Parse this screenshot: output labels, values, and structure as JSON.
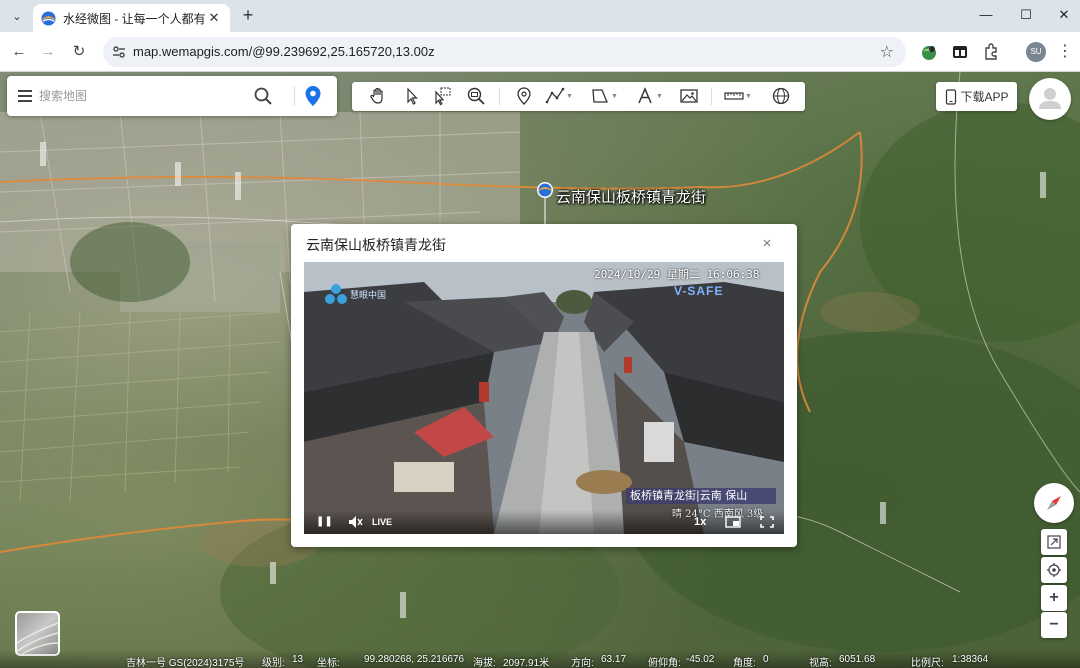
{
  "browser": {
    "tab_title": "水经微图 - 让每一个人都有自己的地图",
    "url": "map.wemapgis.com/@99.239692,25.165720,13.00z",
    "profile_initials": "SU"
  },
  "search": {
    "placeholder": "搜索地图"
  },
  "toolbar": {
    "tools": [
      "pan-hand",
      "select-pointer",
      "select-box",
      "zoom-search",
      "place-marker",
      "draw-line",
      "draw-polygon",
      "text",
      "image",
      "measure",
      "globe"
    ]
  },
  "download_app": "下载APP",
  "marker": {
    "label": "云南保山板桥镇青龙街"
  },
  "popup": {
    "title": "云南保山板桥镇青龙街",
    "close_glyph": "×",
    "video": {
      "overlay_time": "2024/10/29  星期二  16:06:38",
      "brand_small": "慧眼中国",
      "brand_large": "V-SAFE",
      "location_caption": "板桥镇青龙街|云南 保山",
      "weather_caption": "晴 24°C 西南风 3级",
      "live_label": "LIVE",
      "speed_label": "1x"
    }
  },
  "map_controls": {
    "zoom_in": "+",
    "zoom_out": "−"
  },
  "status": {
    "imagery": "吉林一号 GS(2024)3175号",
    "level_label": "级别:",
    "level_value": "13",
    "coord_label": "坐标:",
    "coord_value": "99.280268, 25.216676",
    "elevation_label": "海拔:",
    "elevation_value": "2097.91米",
    "heading_label": "方向:",
    "heading_value": "63.17",
    "pitch_label": "俯仰角:",
    "pitch_value": "-45.02",
    "roll_label": "角度:",
    "roll_value": "0",
    "altitude_label": "视高:",
    "altitude_value": "6051.68",
    "scale_label": "比例尺:",
    "scale_value": "1:38364"
  },
  "colors": {
    "accent_blue": "#1a73e8",
    "marker_blue": "#2196f3",
    "compass_red": "#e53935",
    "road_orange": "#e0893a"
  }
}
